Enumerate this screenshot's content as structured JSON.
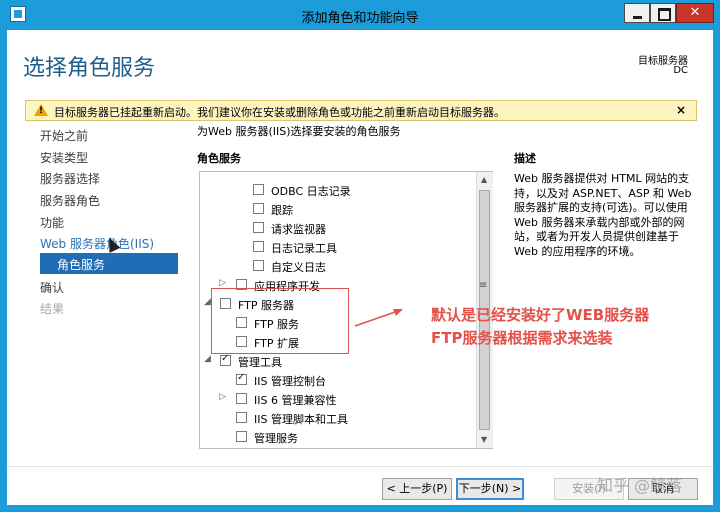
{
  "window": {
    "title": "添加角色和功能向导"
  },
  "header": {
    "page_title": "选择角色服务",
    "target_label": "目标服务器",
    "target_value": "DC"
  },
  "warning": {
    "text": "目标服务器已挂起重新启动。我们建议你在安装或删除角色或功能之前重新启动目标服务器。",
    "close": "×"
  },
  "sidebar": {
    "items": [
      {
        "label": "开始之前",
        "state": "normal"
      },
      {
        "label": "安装类型",
        "state": "normal"
      },
      {
        "label": "服务器选择",
        "state": "normal"
      },
      {
        "label": "服务器角色",
        "state": "normal"
      },
      {
        "label": "功能",
        "state": "normal"
      },
      {
        "label": "Web 服务器角色(IIS)",
        "state": "link"
      },
      {
        "label": "角色服务",
        "state": "selected"
      },
      {
        "label": "确认",
        "state": "normal"
      },
      {
        "label": "结果",
        "state": "disabled"
      }
    ]
  },
  "main": {
    "subtitle": "为Web 服务器(IIS)选择要安装的角色服务",
    "role_services_label": "角色服务",
    "tree": [
      {
        "label": "ODBC 日志记录",
        "checked": false,
        "expander": ""
      },
      {
        "label": "跟踪",
        "checked": false,
        "expander": ""
      },
      {
        "label": "请求监视器",
        "checked": false,
        "expander": ""
      },
      {
        "label": "日志记录工具",
        "checked": false,
        "expander": ""
      },
      {
        "label": "自定义日志",
        "checked": false,
        "expander": ""
      },
      {
        "label": "应用程序开发",
        "checked": false,
        "expander": "▷"
      },
      {
        "label": "FTP 服务器",
        "checked": false,
        "expander": "◢"
      },
      {
        "label": "FTP 服务",
        "checked": false,
        "expander": ""
      },
      {
        "label": "FTP 扩展",
        "checked": false,
        "expander": ""
      },
      {
        "label": "管理工具",
        "checked": true,
        "expander": "◢"
      },
      {
        "label": "IIS 管理控制台",
        "checked": true,
        "expander": ""
      },
      {
        "label": "IIS 6 管理兼容性",
        "checked": false,
        "expander": "▷"
      },
      {
        "label": "IIS 管理脚本和工具",
        "checked": false,
        "expander": ""
      },
      {
        "label": "管理服务",
        "checked": false,
        "expander": ""
      }
    ]
  },
  "description": {
    "label": "描述",
    "text": "Web 服务器提供对 HTML 网站的支持，以及对 ASP.NET、ASP 和 Web 服务器扩展的支持(可选)。可以使用 Web 服务器来承载内部或外部的网站，或者为开发人员提供创建基于 Web 的应用程序的环境。"
  },
  "annotation": {
    "line1": "默认是已经安装好了WEB服务器",
    "line2": "FTP服务器根据需求来选装"
  },
  "buttons": {
    "previous": "< 上一步(P)",
    "next": "下一步(N) >",
    "install": "安装(I)",
    "cancel": "取消"
  },
  "watermark": "知乎 @鲸落",
  "colors": {
    "title_bar": "#1c9dd9",
    "page_title": "#1e5f8c",
    "selected_nav": "#1f6db5",
    "annotation": "#e4514a",
    "warning_bg": "#fdf4bf"
  }
}
